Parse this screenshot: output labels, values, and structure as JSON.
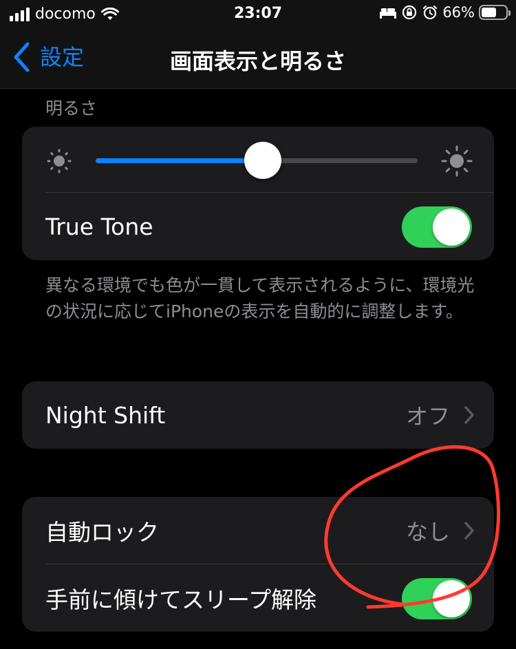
{
  "status_bar": {
    "carrier": "docomo",
    "time": "23:07",
    "battery_percent": "66%",
    "battery_level": 0.66,
    "icons": [
      "signal-icon",
      "wifi-icon",
      "bed-icon",
      "orientation-lock-icon",
      "alarm-icon",
      "battery-icon"
    ]
  },
  "nav": {
    "back_label": "設定",
    "title": "画面表示と明るさ"
  },
  "brightness": {
    "section_header": "明るさ",
    "level": 0.52,
    "true_tone_label": "True Tone",
    "true_tone_on": true,
    "footer": "異なる環境でも色が一貫して表示されるように、環境光の状況に応じてiPhoneの表示を自動的に調整します。"
  },
  "night_shift": {
    "label": "Night Shift",
    "value": "オフ"
  },
  "lock": {
    "auto_lock_label": "自動ロック",
    "auto_lock_value": "なし",
    "raise_to_wake_label": "手前に傾けてスリープ解除",
    "raise_to_wake_on": true
  },
  "colors": {
    "accent": "#0a84ff",
    "toggle_on": "#30d158",
    "annotation": "#ff3b30"
  }
}
